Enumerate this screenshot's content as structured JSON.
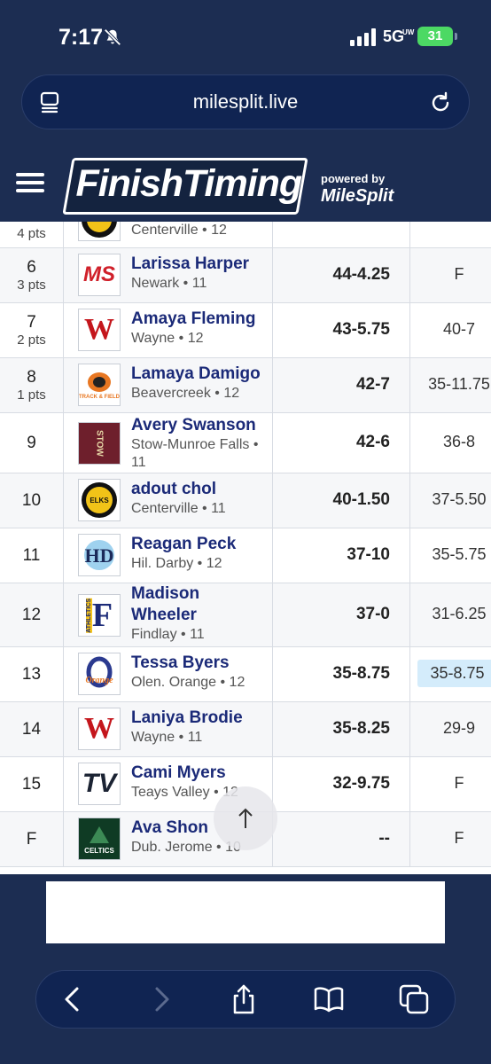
{
  "status": {
    "time": "7:17",
    "network": "5G",
    "network_sub": "UW",
    "battery": "31"
  },
  "browser": {
    "url": "milesplit.live"
  },
  "header": {
    "brand": "FinishTiming",
    "powered_by": "powered by",
    "powered_brand": "MileSplit"
  },
  "rows": [
    {
      "place": "",
      "pts": "4 pts",
      "athlete": "",
      "team": "Centerville • 12",
      "mark": "",
      "seed": "",
      "logo": "centerville-logo"
    },
    {
      "place": "6",
      "pts": "3 pts",
      "athlete": "Larissa Harper",
      "team": "Newark • 11",
      "mark": "44-4.25",
      "seed": "F",
      "logo": "newark-logo"
    },
    {
      "place": "7",
      "pts": "2 pts",
      "athlete": "Amaya Fleming",
      "team": "Wayne • 12",
      "mark": "43-5.75",
      "seed": "40-7",
      "logo": "wayne-logo"
    },
    {
      "place": "8",
      "pts": "1 pts",
      "athlete": "Lamaya Damigo",
      "team": "Beavercreek • 12",
      "mark": "42-7",
      "seed": "35-11.75",
      "logo": "beavercreek-logo"
    },
    {
      "place": "9",
      "pts": "",
      "athlete": "Avery Swanson",
      "team": "Stow-Munroe Falls • 11",
      "mark": "42-6",
      "seed": "36-8",
      "logo": "stow-logo"
    },
    {
      "place": "10",
      "pts": "",
      "athlete": "adout chol",
      "team": "Centerville • 11",
      "mark": "40-1.50",
      "seed": "37-5.50",
      "logo": "centerville-logo"
    },
    {
      "place": "11",
      "pts": "",
      "athlete": "Reagan Peck",
      "team": "Hil. Darby • 12",
      "mark": "37-10",
      "seed": "35-5.75",
      "logo": "hilliard-darby-logo"
    },
    {
      "place": "12",
      "pts": "",
      "athlete": "Madison Wheeler",
      "team": "Findlay • 11",
      "mark": "37-0",
      "seed": "31-6.25",
      "logo": "findlay-logo"
    },
    {
      "place": "13",
      "pts": "",
      "athlete": "Tessa Byers",
      "team": "Olen. Orange • 12",
      "mark": "35-8.75",
      "seed": "35-8.75",
      "logo": "olentangy-orange-logo"
    },
    {
      "place": "14",
      "pts": "",
      "athlete": "Laniya Brodie",
      "team": "Wayne • 11",
      "mark": "35-8.25",
      "seed": "29-9",
      "logo": "wayne-logo"
    },
    {
      "place": "15",
      "pts": "",
      "athlete": "Cami Myers",
      "team": "Teays Valley • 12",
      "mark": "32-9.75",
      "seed": "F",
      "logo": "teays-valley-logo"
    },
    {
      "place": "F",
      "pts": "",
      "athlete": "Ava Shon",
      "team": "Dub. Jerome • 10",
      "mark": "--",
      "seed": "F",
      "logo": "dublin-jerome-logo"
    }
  ],
  "logo_texts": {
    "ms": "MS",
    "w": "W",
    "elks": "ELKS",
    "stow": "STOW",
    "f": "F",
    "athletics": "ATHLETICS",
    "orange": "Orange",
    "tv": "TV",
    "celtics": "CELTICS",
    "track": "TRACK & FIELD"
  }
}
